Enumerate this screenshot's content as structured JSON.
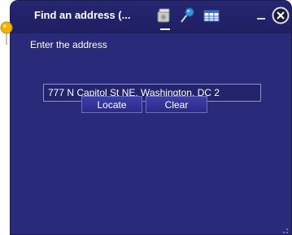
{
  "widget": {
    "title": "Find an address (...",
    "prompt": "Enter the address",
    "address_value": "777 N Capitol St NE, Washington, DC 2",
    "locate_label": "Locate",
    "clear_label": "Clear"
  },
  "icons": {
    "pin": "map-pin-icon",
    "address": "address-book-icon",
    "pushpin": "pushpin-icon",
    "table": "table-icon",
    "minimize": "minimize-icon",
    "close": "close-icon",
    "resize": "resize-grip-icon"
  },
  "colors": {
    "panel": "#2a2a7a",
    "titlebar": "#1f1f62",
    "button": "#3e3ea8",
    "pin": "#f2b300"
  }
}
